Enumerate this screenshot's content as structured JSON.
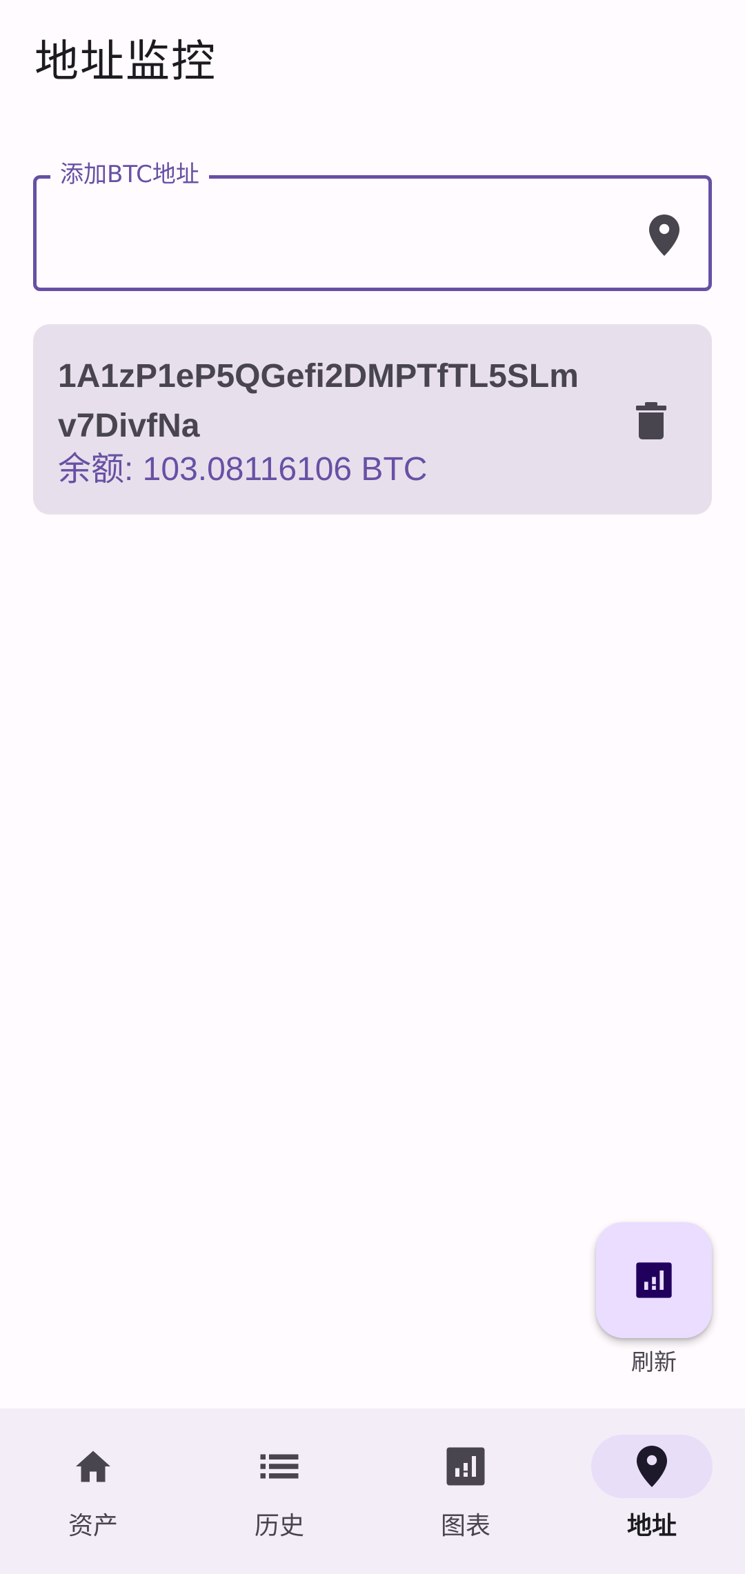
{
  "header": {
    "title": "地址监控"
  },
  "add_field": {
    "label": "添加BTC地址",
    "value": "",
    "placeholder": "",
    "icon": "location-pin-icon"
  },
  "addresses": [
    {
      "address": "1A1zP1eP5QGefi2DMPTfTL5SLmv7DivfNa",
      "balance": "余额: 103.08116106 BTC",
      "delete_icon": "trash-icon"
    }
  ],
  "fab": {
    "label": "刷新",
    "icon": "bar-chart-icon"
  },
  "bottom_nav": {
    "items": [
      {
        "label": "资产",
        "icon": "home-icon",
        "active": false
      },
      {
        "label": "历史",
        "icon": "list-icon",
        "active": false
      },
      {
        "label": "图表",
        "icon": "bar-chart-icon",
        "active": false
      },
      {
        "label": "地址",
        "icon": "location-pin-icon",
        "active": true
      }
    ]
  },
  "colors": {
    "primary": "#6750a4",
    "background": "#fffbfe",
    "card": "#e7e0ec",
    "fab": "#eaddff",
    "nav_background": "#f3edf7",
    "nav_indicator": "#e8def8"
  }
}
